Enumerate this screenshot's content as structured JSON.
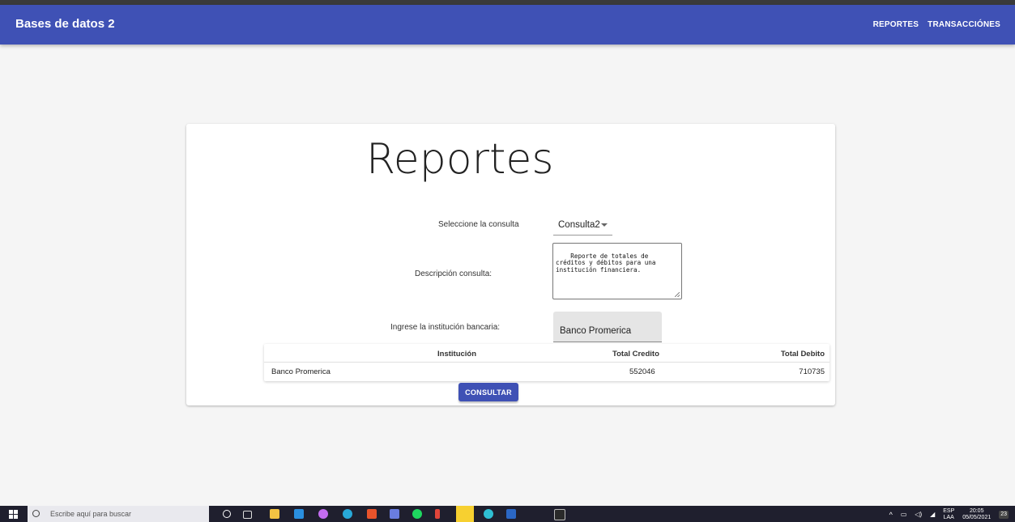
{
  "app": {
    "title": "Bases de datos 2"
  },
  "nav": {
    "items": [
      "REPORTES",
      "TRANSACCIÓNES"
    ]
  },
  "card": {
    "title": "Reportes",
    "select_label": "Seleccione la consulta",
    "select_value": "Consulta2",
    "description_label": "Descripción consulta:",
    "description_value": "Reporte de totales de créditos y débitos para una institución financiera.",
    "bank_label": "Ingrese la institución bancaria:",
    "bank_value": "Banco Promerica",
    "consult_button": "CONSULTAR"
  },
  "table": {
    "headers": [
      "Institución",
      "Total Credito",
      "Total Debito"
    ],
    "rows": [
      [
        "Banco Promerica",
        "552046",
        "710735"
      ]
    ]
  },
  "taskbar": {
    "search_placeholder": "Escribe aquí para buscar",
    "language": "ESP",
    "region": "LAA",
    "time": "20:05",
    "date": "05/05/2021",
    "notifications": "23"
  },
  "colors": {
    "primary": "#3f51b5",
    "taskbar": "#1f1f2e"
  },
  "icons": [
    "windows-start-icon",
    "search-icon",
    "cortana-icon",
    "task-view-icon",
    "file-explorer-icon",
    "vscode-icon",
    "github-icon",
    "edge-icon",
    "office-icon",
    "security-icon",
    "spotify-icon",
    "app-icon",
    "sticky-notes-icon",
    "edge-beta-icon",
    "word-icon",
    "terminal-icon",
    "notification-icon"
  ]
}
